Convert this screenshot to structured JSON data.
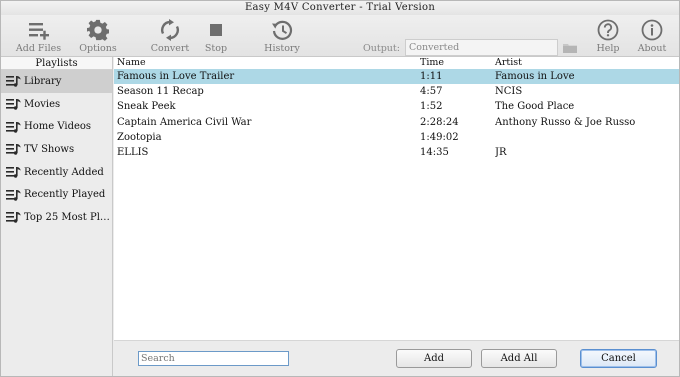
{
  "app": {
    "title": "Easy M4V Converter - Trial Version"
  },
  "toolbar": {
    "add_files": "Add Files",
    "options": "Options",
    "convert": "Convert",
    "stop": "Stop",
    "history": "History",
    "output_label": "Output:",
    "output_value": "Converted",
    "help": "Help",
    "about": "About"
  },
  "sidebar": {
    "header": "Playlists",
    "items": [
      {
        "label": "Library",
        "selected": true
      },
      {
        "label": "Movies"
      },
      {
        "label": "Home Videos"
      },
      {
        "label": "TV Shows"
      },
      {
        "label": "Recently Added"
      },
      {
        "label": "Recently Played"
      },
      {
        "label": "Top 25 Most Pl…"
      }
    ]
  },
  "table": {
    "columns": {
      "name": "Name",
      "time": "Time",
      "artist": "Artist"
    },
    "rows": [
      {
        "name": "Famous in Love  Trailer",
        "time": "1:11",
        "artist": "Famous in Love",
        "selected": true
      },
      {
        "name": "Season 11 Recap",
        "time": "4:57",
        "artist": "NCIS"
      },
      {
        "name": "Sneak Peek",
        "time": "1:52",
        "artist": "The Good Place"
      },
      {
        "name": "Captain America  Civil War",
        "time": "2:28:24",
        "artist": "Anthony Russo & Joe Russo"
      },
      {
        "name": "Zootopia",
        "time": "1:49:02",
        "artist": ""
      },
      {
        "name": "ELLIS",
        "time": "14:35",
        "artist": "JR"
      }
    ]
  },
  "bottom": {
    "search_placeholder": "Search",
    "add": "Add",
    "add_all": "Add All",
    "cancel": "Cancel"
  },
  "colors": {
    "selection": "#add8e6",
    "toolbar_icon": "#6e6e6e",
    "search_border": "#6c9ac8"
  }
}
